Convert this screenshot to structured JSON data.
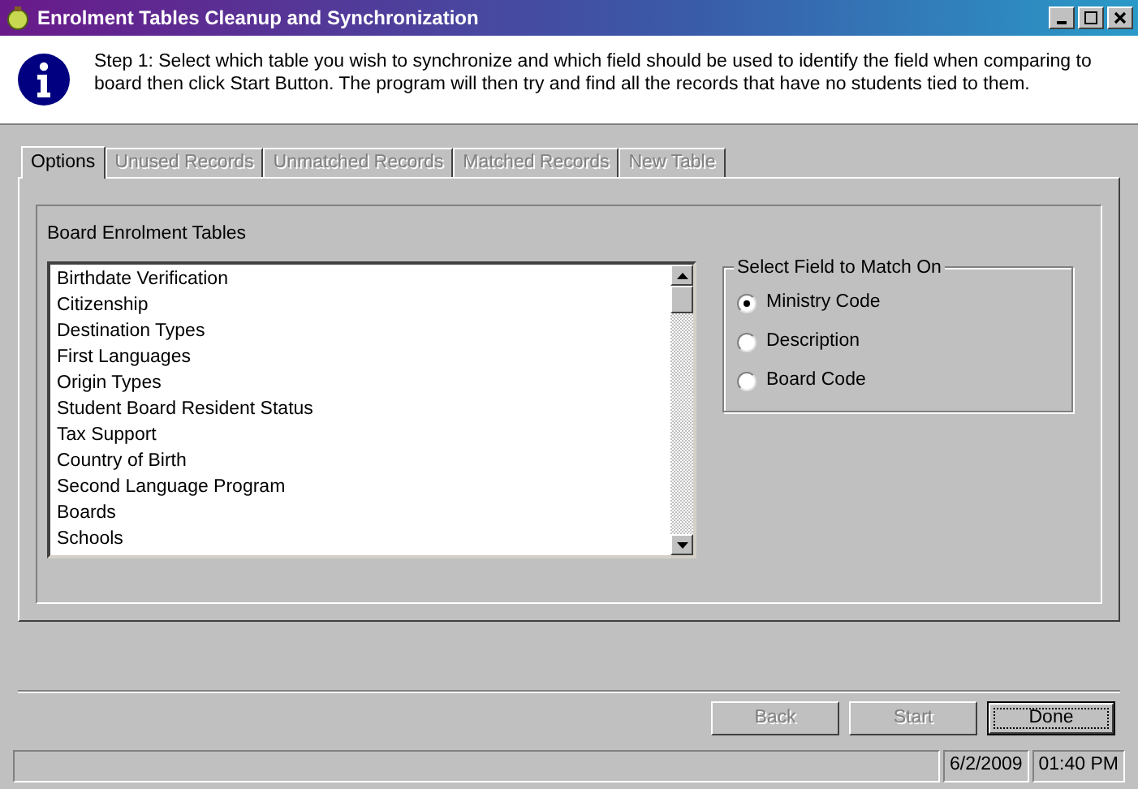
{
  "window": {
    "title": "Enrolment Tables Cleanup and Synchronization"
  },
  "instructions": "Step 1: Select which table you wish to synchronize and which field should be used to identify the field when comparing to board then click Start Button. The program will then try and find all  the records that have no students tied to them.",
  "tabs": [
    {
      "label": "Options",
      "selected": true,
      "disabled": false
    },
    {
      "label": "Unused Records",
      "selected": false,
      "disabled": true
    },
    {
      "label": "Unmatched Records",
      "selected": false,
      "disabled": true
    },
    {
      "label": "Matched Records",
      "selected": false,
      "disabled": true
    },
    {
      "label": "New Table",
      "selected": false,
      "disabled": true
    }
  ],
  "tables": {
    "label": "Board Enrolment Tables",
    "items": [
      "Birthdate Verification",
      "Citizenship",
      "Destination Types",
      "First Languages",
      "Origin Types",
      "Student Board Resident Status",
      "Tax Support",
      "Country of Birth",
      "Second Language Program",
      "Boards",
      "Schools"
    ]
  },
  "match_field": {
    "label": "Select Field to Match On",
    "options": [
      {
        "label": "Ministry Code",
        "selected": true
      },
      {
        "label": "Description",
        "selected": false
      },
      {
        "label": "Board Code",
        "selected": false
      }
    ]
  },
  "buttons": [
    {
      "label": "Back",
      "disabled": true,
      "default": false
    },
    {
      "label": "Start",
      "disabled": true,
      "default": false
    },
    {
      "label": "Done",
      "disabled": false,
      "default": true
    }
  ],
  "status_bar": {
    "date": "6/2/2009",
    "time": "01:40 PM"
  }
}
